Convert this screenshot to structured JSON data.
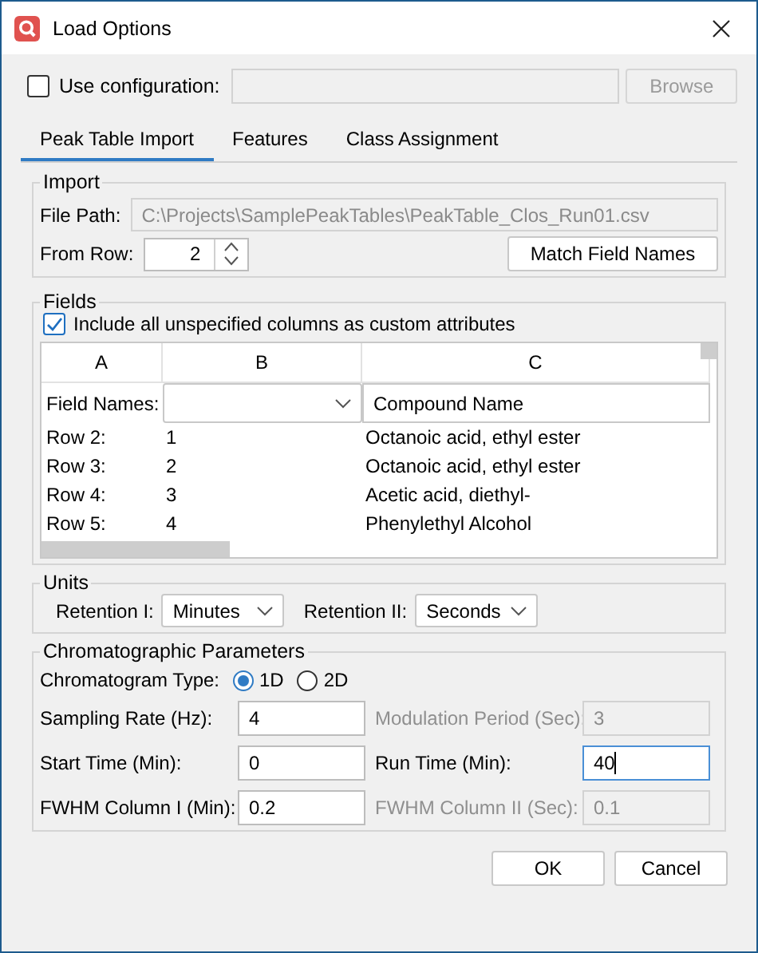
{
  "window": {
    "title": "Load Options"
  },
  "config": {
    "label": "Use configuration:",
    "checked": false,
    "browse": {
      "label": "Browse",
      "disabled": true
    }
  },
  "tabs": [
    {
      "label": "Peak Table Import",
      "selected": true
    },
    {
      "label": "Features",
      "selected": false
    },
    {
      "label": "Class Assignment",
      "selected": false
    }
  ],
  "import": {
    "title": "Import",
    "file_path": {
      "label": "File Path:",
      "value": "C:\\Projects\\SamplePeakTables\\PeakTable_Clos_Run01.csv",
      "disabled": true
    },
    "from_row": {
      "label": "From Row:",
      "value": "2"
    },
    "match_button": "Match Field Names"
  },
  "fields": {
    "title": "Fields",
    "include": {
      "label": "Include all unspecified columns as custom attributes",
      "checked": true
    },
    "table": {
      "columns": [
        "A",
        "B",
        "C"
      ],
      "field_names_label": "Field Names:",
      "field_names": [
        {
          "kind": "dropdown"
        },
        {
          "kind": "text",
          "value": "Compound Name"
        }
      ],
      "rows": [
        [
          "Row 2:",
          "1",
          "Octanoic acid, ethyl ester"
        ],
        [
          "Row 3:",
          "2",
          "Octanoic acid, ethyl ester"
        ],
        [
          "Row 4:",
          "3",
          "Acetic acid, diethyl-"
        ],
        [
          "Row 5:",
          "4",
          "Phenylethyl Alcohol"
        ]
      ]
    }
  },
  "units": {
    "title": "Units",
    "selects": [
      {
        "label": "Retention I:",
        "value": "Minutes"
      },
      {
        "label": "Retention II:",
        "value": "Seconds"
      }
    ]
  },
  "chromatographic": {
    "title": "Chromatographic Parameters",
    "type": {
      "label": "Chromatogram Type:",
      "options": [
        {
          "label": "1D",
          "selected": true
        },
        {
          "label": "2D",
          "selected": false
        }
      ]
    },
    "params": [
      {
        "label": "Sampling Rate (Hz):",
        "value": "4",
        "disabled": false,
        "focused": false
      },
      {
        "label": "Modulation Period (Sec):",
        "value": "3",
        "disabled": true,
        "focused": false
      },
      {
        "label": "Start Time (Min):",
        "value": "0",
        "disabled": false,
        "focused": false
      },
      {
        "label": "Run Time (Min):",
        "value": "40",
        "disabled": false,
        "focused": true
      },
      {
        "label": "FWHM Column I (Min):",
        "value": "0.2",
        "disabled": false,
        "focused": false
      },
      {
        "label": "FWHM Column II (Sec):",
        "value": "0.1",
        "disabled": true,
        "focused": false
      }
    ]
  },
  "buttons": [
    "OK",
    "Cancel"
  ]
}
